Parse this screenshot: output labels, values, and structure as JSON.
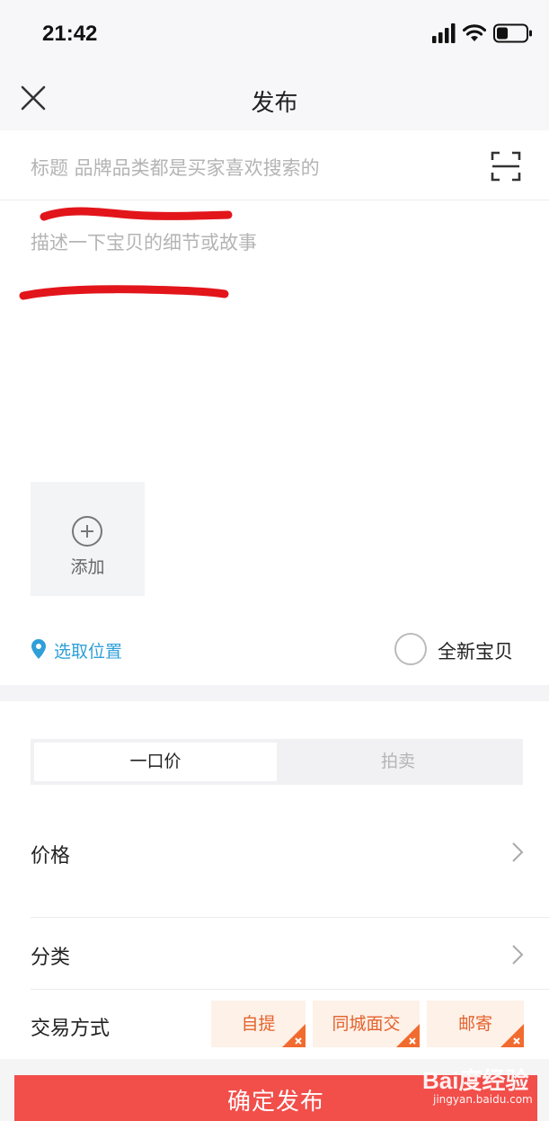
{
  "status_bar": {
    "time": "21:42"
  },
  "nav": {
    "title": "发布"
  },
  "form": {
    "title_placeholder": "标题 品牌品类都是买家喜欢搜索的",
    "description_placeholder": "描述一下宝贝的细节或故事",
    "add_photo_label": "添加",
    "location_label": "选取位置",
    "brand_new_label": "全新宝贝"
  },
  "pricing": {
    "tabs": [
      {
        "label": "一口价",
        "selected": true
      },
      {
        "label": "拍卖",
        "selected": false
      }
    ],
    "price_label": "价格",
    "category_label": "分类",
    "trade_label": "交易方式",
    "trade_options": [
      {
        "label": "自提",
        "selected": true
      },
      {
        "label": "同城面交",
        "selected": true
      },
      {
        "label": "邮寄",
        "selected": true
      }
    ]
  },
  "submit": {
    "label": "确定发布"
  },
  "watermark": {
    "brand": "Bai度经验",
    "url": "jingyan.baidu.com"
  },
  "colors": {
    "accent_red": "#f24e4a",
    "location_blue": "#2f9fd8",
    "chip_orange": "#e5622d",
    "chip_bg": "#fdf1e8"
  }
}
